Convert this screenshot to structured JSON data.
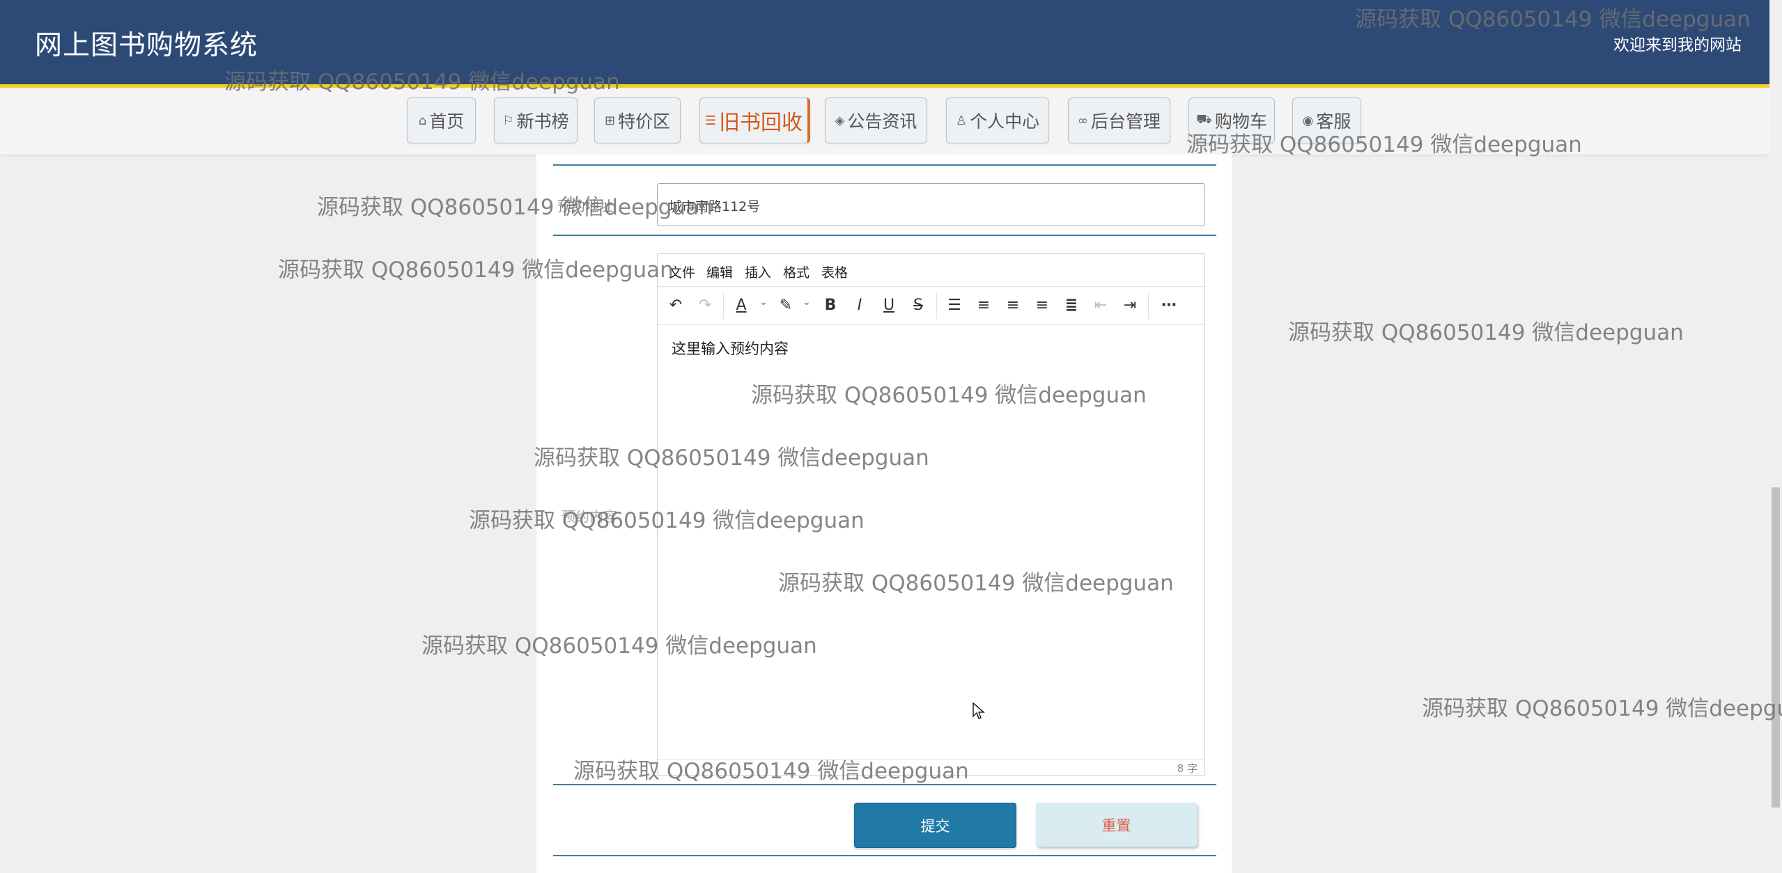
{
  "header": {
    "title": "网上图书购物系统",
    "welcome": "欢迎来到我的网站"
  },
  "nav": {
    "home": "首页",
    "new_books": "新书榜",
    "specials": "特价区",
    "recycle": "旧书回收",
    "news": "公告资讯",
    "profile": "个人中心",
    "admin": "后台管理",
    "cart": "购物车",
    "service": "客服"
  },
  "form": {
    "address_label": "预约地址",
    "address_value": "城市南路112号",
    "content_label": "预约内容",
    "editor": {
      "menu": [
        "文件",
        "编辑",
        "插入",
        "格式",
        "表格"
      ],
      "content": "这里输入预约内容",
      "word_count": "8 字"
    },
    "submit_label": "提交",
    "reset_label": "重置"
  },
  "watermark": {
    "text": "源码获取 QQ86050149 微信deepguan",
    "text_cut": "源码获取 QQ86050149 微信deepgua"
  },
  "colors": {
    "header_bg": "#2d4a77",
    "header_accent": "#f2d21c",
    "active_nav": "#d35a1a",
    "submit_bg": "#2179a8",
    "reset_bg": "#d8ecf2",
    "reset_text": "#e0614f"
  }
}
